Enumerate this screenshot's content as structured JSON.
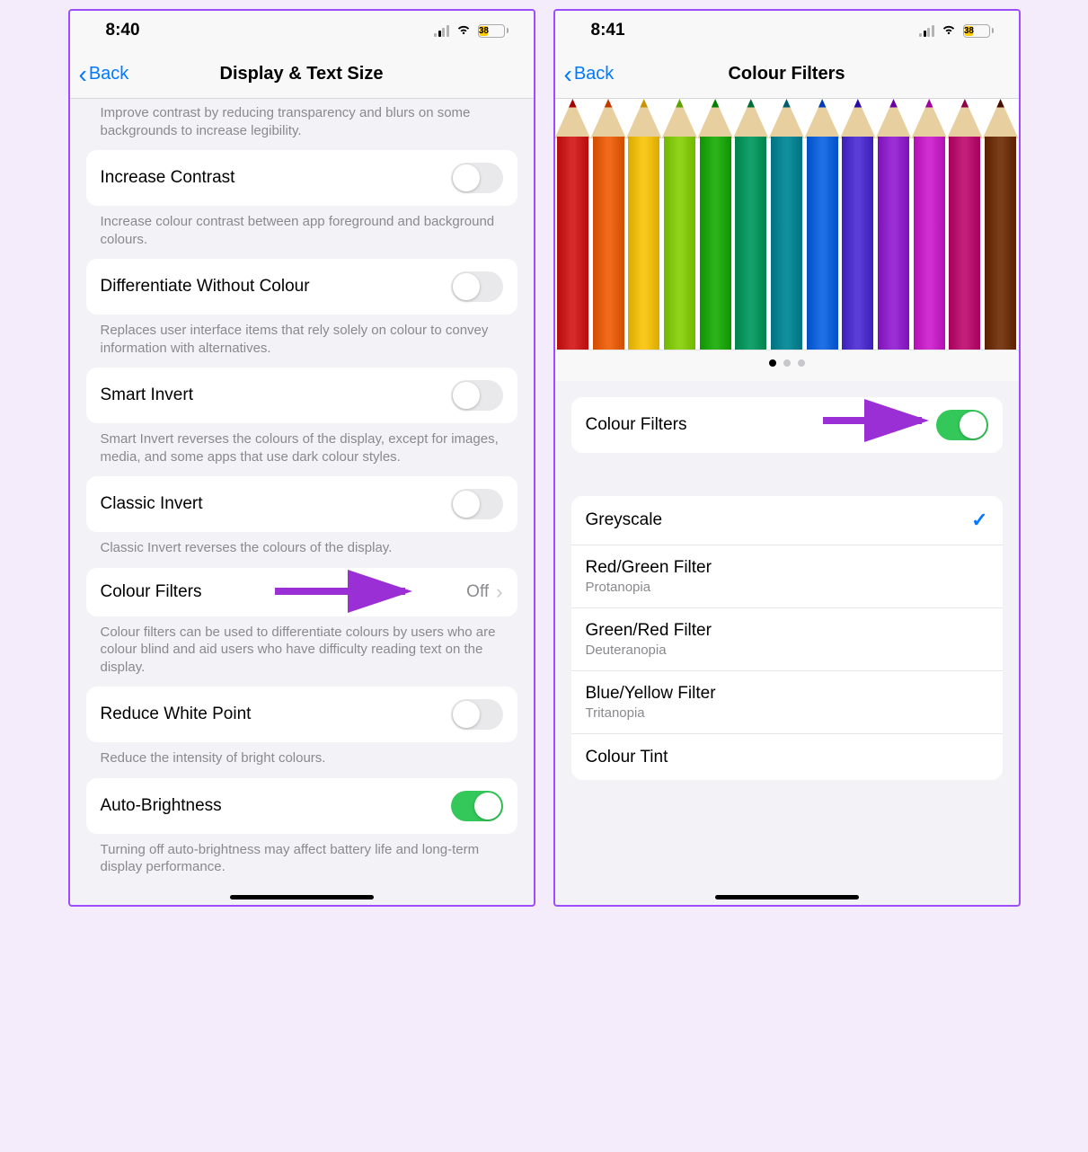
{
  "left": {
    "status": {
      "time": "8:40",
      "battery": "38"
    },
    "nav": {
      "back": "Back",
      "title": "Display & Text Size"
    },
    "cutHeader": "Improve contrast by reducing transparency and blurs on some backgrounds to increase legibility.",
    "rows": {
      "increaseContrast": {
        "label": "Increase Contrast",
        "footer": "Increase colour contrast between app foreground and background colours."
      },
      "diffWithoutColour": {
        "label": "Differentiate Without Colour",
        "footer": "Replaces user interface items that rely solely on colour to convey information with alternatives."
      },
      "smartInvert": {
        "label": "Smart Invert",
        "footer": "Smart Invert reverses the colours of the display, except for images, media, and some apps that use dark colour styles."
      },
      "classicInvert": {
        "label": "Classic Invert",
        "footer": "Classic Invert reverses the colours of the display."
      },
      "colourFilters": {
        "label": "Colour Filters",
        "value": "Off",
        "footer": "Colour filters can be used to differentiate colours by users who are colour blind and aid users who have difficulty reading text on the display."
      },
      "reduceWhitePoint": {
        "label": "Reduce White Point",
        "footer": "Reduce the intensity of bright colours."
      },
      "autoBrightness": {
        "label": "Auto-Brightness",
        "footer": "Turning off auto-brightness may affect battery life and long-term display performance."
      }
    }
  },
  "right": {
    "status": {
      "time": "8:41",
      "battery": "38"
    },
    "nav": {
      "back": "Back",
      "title": "Colour Filters"
    },
    "toggle": {
      "label": "Colour Filters"
    },
    "options": [
      {
        "title": "Greyscale",
        "sub": "",
        "selected": true
      },
      {
        "title": "Red/Green Filter",
        "sub": "Protanopia",
        "selected": false
      },
      {
        "title": "Green/Red Filter",
        "sub": "Deuteranopia",
        "selected": false
      },
      {
        "title": "Blue/Yellow Filter",
        "sub": "Tritanopia",
        "selected": false
      },
      {
        "title": "Colour Tint",
        "sub": "",
        "selected": false
      }
    ],
    "pencilColors": [
      "#d62a2a",
      "#f06a1a",
      "#f8c81c",
      "#8fd41a",
      "#2bb21a",
      "#13a06a",
      "#118f9d",
      "#1e6ee6",
      "#5a3cd6",
      "#9b2fd6",
      "#d12ed1",
      "#c21e7a",
      "#7a3e1a"
    ]
  },
  "arrowColor": "#9b2fd6"
}
